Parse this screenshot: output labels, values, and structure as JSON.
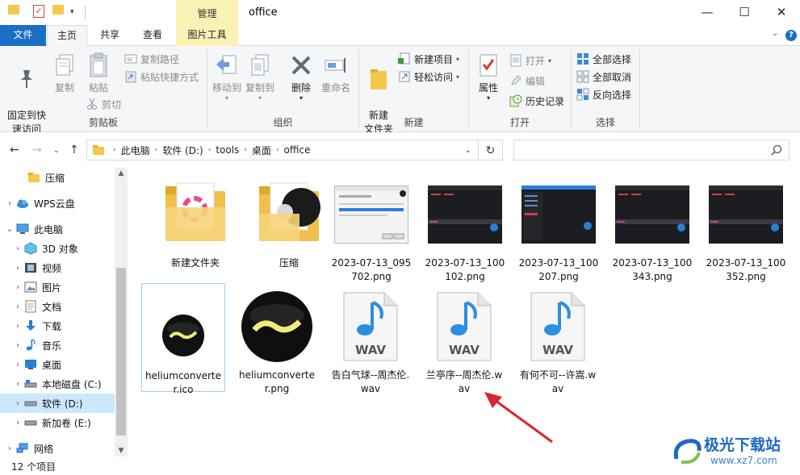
{
  "window": {
    "title": "office",
    "contextual_tab": "管理",
    "minimize": "—",
    "maximize": "☐",
    "close": "✕"
  },
  "tabs": [
    {
      "label": "文件"
    },
    {
      "label": "主页"
    },
    {
      "label": "共享"
    },
    {
      "label": "查看"
    },
    {
      "label": "图片工具"
    }
  ],
  "ribbon": {
    "clipboard": {
      "group_label": "剪贴板",
      "pin": "固定到快\n速访问",
      "copy": "复制",
      "paste": "粘贴",
      "copy_path": "复制路径",
      "paste_shortcut": "粘贴快捷方式",
      "cut": "剪切"
    },
    "organize": {
      "group_label": "组织",
      "move_to": "移动到",
      "copy_to": "复制到",
      "delete": "删除",
      "rename": "重命名"
    },
    "new": {
      "group_label": "新建",
      "new_folder": "新建\n文件夹",
      "new_item": "新建项目",
      "easy_access": "轻松访问"
    },
    "open": {
      "group_label": "打开",
      "properties": "属性",
      "open": "打开",
      "edit": "编辑",
      "history": "历史记录"
    },
    "select": {
      "group_label": "选择",
      "select_all": "全部选择",
      "select_none": "全部取消",
      "invert": "反向选择"
    }
  },
  "address": {
    "crumbs": [
      "此电脑",
      "软件 (D:)",
      "tools",
      "桌面",
      "office"
    ]
  },
  "nav": [
    {
      "label": "压缩",
      "icon": "folder-icon"
    },
    {
      "label": "WPS云盘",
      "icon": "cloud-icon"
    },
    {
      "label": "此电脑",
      "icon": "computer-icon"
    },
    {
      "label": "3D 对象",
      "icon": "3d-objects-icon"
    },
    {
      "label": "视频",
      "icon": "video-icon"
    },
    {
      "label": "图片",
      "icon": "pictures-icon"
    },
    {
      "label": "文档",
      "icon": "documents-icon"
    },
    {
      "label": "下载",
      "icon": "download-icon"
    },
    {
      "label": "音乐",
      "icon": "music-icon"
    },
    {
      "label": "桌面",
      "icon": "desktop-icon"
    },
    {
      "label": "本地磁盘 (C:)",
      "icon": "drive-icon"
    },
    {
      "label": "软件 (D:)",
      "icon": "drive-icon"
    },
    {
      "label": "新加卷 (E:)",
      "icon": "drive-icon"
    },
    {
      "label": "网络",
      "icon": "network-icon"
    }
  ],
  "files": [
    {
      "name": "新建文件夹",
      "type": "folder"
    },
    {
      "name": "压缩",
      "type": "folder"
    },
    {
      "name": "2023-07-13_095702.png",
      "type": "png"
    },
    {
      "name": "2023-07-13_100102.png",
      "type": "png"
    },
    {
      "name": "2023-07-13_100207.png",
      "type": "png"
    },
    {
      "name": "2023-07-13_100343.png",
      "type": "png"
    },
    {
      "name": "2023-07-13_100352.png",
      "type": "png"
    },
    {
      "name": "heliumconverter.ico",
      "type": "ico"
    },
    {
      "name": "heliumconverter.png",
      "type": "png"
    },
    {
      "name": "告白气球--周杰伦.wav",
      "type": "wav"
    },
    {
      "name": "兰亭序--周杰伦.wav",
      "type": "wav"
    },
    {
      "name": "有何不可--许嵩.wav",
      "type": "wav"
    }
  ],
  "wav_badge": "WAV",
  "status": {
    "count": "12 个项目"
  },
  "watermark": {
    "name": "极光下载站",
    "url": "www.xz7.com"
  },
  "colors": {
    "accent": "#1a6fc4",
    "selection": "#cce8ff",
    "folder": "#f5c84c",
    "annotation_arrow": "#d9262b"
  }
}
